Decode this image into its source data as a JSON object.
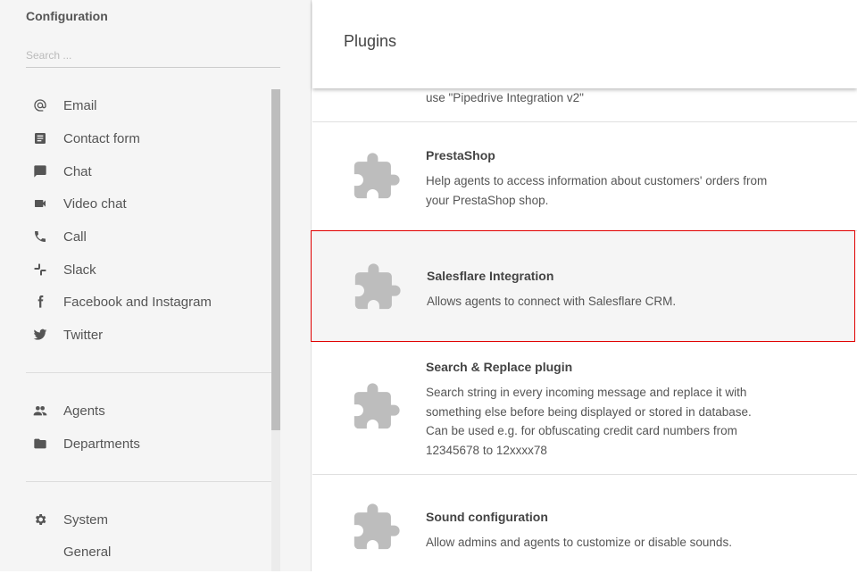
{
  "sidebar": {
    "title": "Configuration",
    "search_placeholder": "Search ...",
    "items": [
      {
        "label": "Email",
        "icon": "at-icon"
      },
      {
        "label": "Contact form",
        "icon": "form-icon"
      },
      {
        "label": "Chat",
        "icon": "chat-icon"
      },
      {
        "label": "Video chat",
        "icon": "video-icon"
      },
      {
        "label": "Call",
        "icon": "phone-icon"
      },
      {
        "label": "Slack",
        "icon": "slack-icon"
      },
      {
        "label": "Facebook and Instagram",
        "icon": "facebook-icon"
      },
      {
        "label": "Twitter",
        "icon": "twitter-icon"
      },
      {
        "label": "Agents",
        "icon": "people-icon"
      },
      {
        "label": "Departments",
        "icon": "folder-icon"
      },
      {
        "label": "System",
        "icon": "gear-icon"
      },
      {
        "label": "General",
        "icon": ""
      }
    ]
  },
  "main": {
    "title": "Plugins",
    "plugins": [
      {
        "title": "",
        "desc": "use \"Pipedrive Integration v2\""
      },
      {
        "title": "PrestaShop",
        "desc": "Help agents to access information about customers' orders from your PrestaShop shop."
      },
      {
        "title": "Salesflare Integration",
        "desc": "Allows agents to connect with Salesflare CRM."
      },
      {
        "title": "Search & Replace plugin",
        "desc": "Search string in every incoming message and replace it with something else before being displayed or stored in database. Can be used e.g. for obfuscating credit card numbers from 12345678 to 12xxxx78"
      },
      {
        "title": "Sound configuration",
        "desc": "Allow admins and agents to customize or disable sounds."
      }
    ]
  },
  "colors": {
    "highlight": "#e00000",
    "icon": "#bdbdbd"
  }
}
